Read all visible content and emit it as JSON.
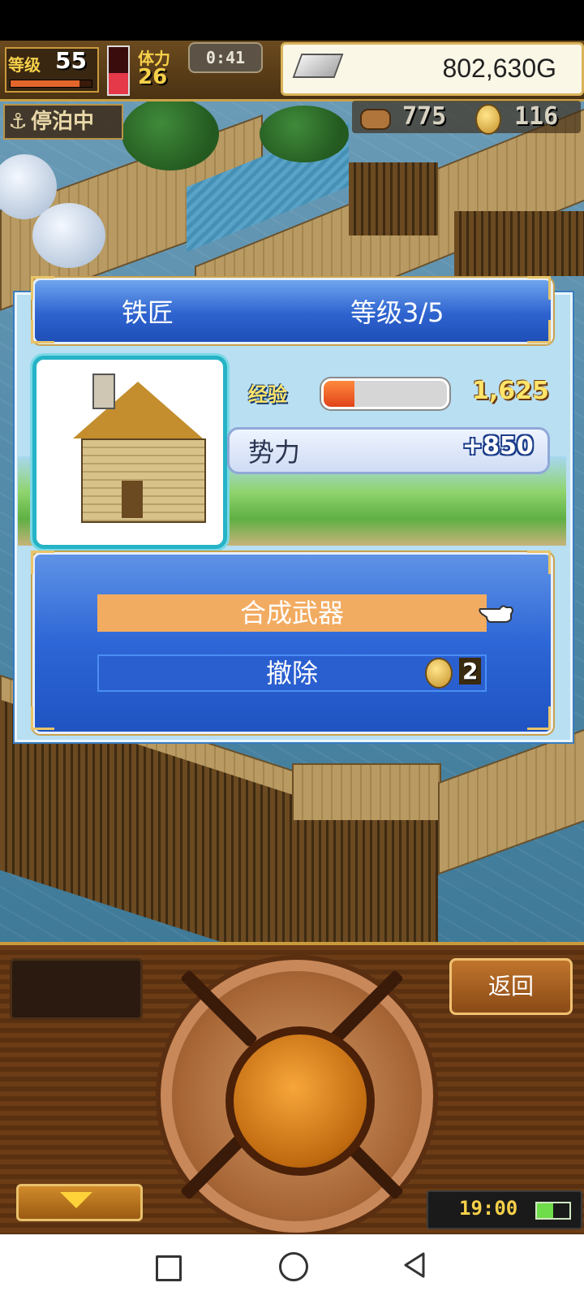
{
  "hud": {
    "level_label": "等级",
    "level_value": "55",
    "level_progress": 0.85,
    "stamina_label": "体力",
    "stamina_value": "26",
    "stamina_fraction": 0.45,
    "timer": "0:41",
    "gold_value": "802,630G",
    "docked_anchor_icon": "anchor-icon",
    "docked_label": "停泊中",
    "wood_value": "775",
    "medal_value": "116"
  },
  "dialog": {
    "title": "铁匠",
    "level_text": "等级3/5",
    "exp_label": "经验",
    "exp_fraction": 0.25,
    "exp_value": "1,625",
    "power_label": "势力",
    "power_value": "+850",
    "actions": {
      "craft_label": "合成武器",
      "remove_label": "撤除",
      "remove_cost": "2"
    }
  },
  "console": {
    "back_label": "返回",
    "clock": "19:00",
    "battery_fraction": 0.5
  },
  "colors": {
    "accent_gold": "#c9a24a",
    "dialog_blue": "#2e63cf",
    "selected_action": "#f2ac62"
  }
}
